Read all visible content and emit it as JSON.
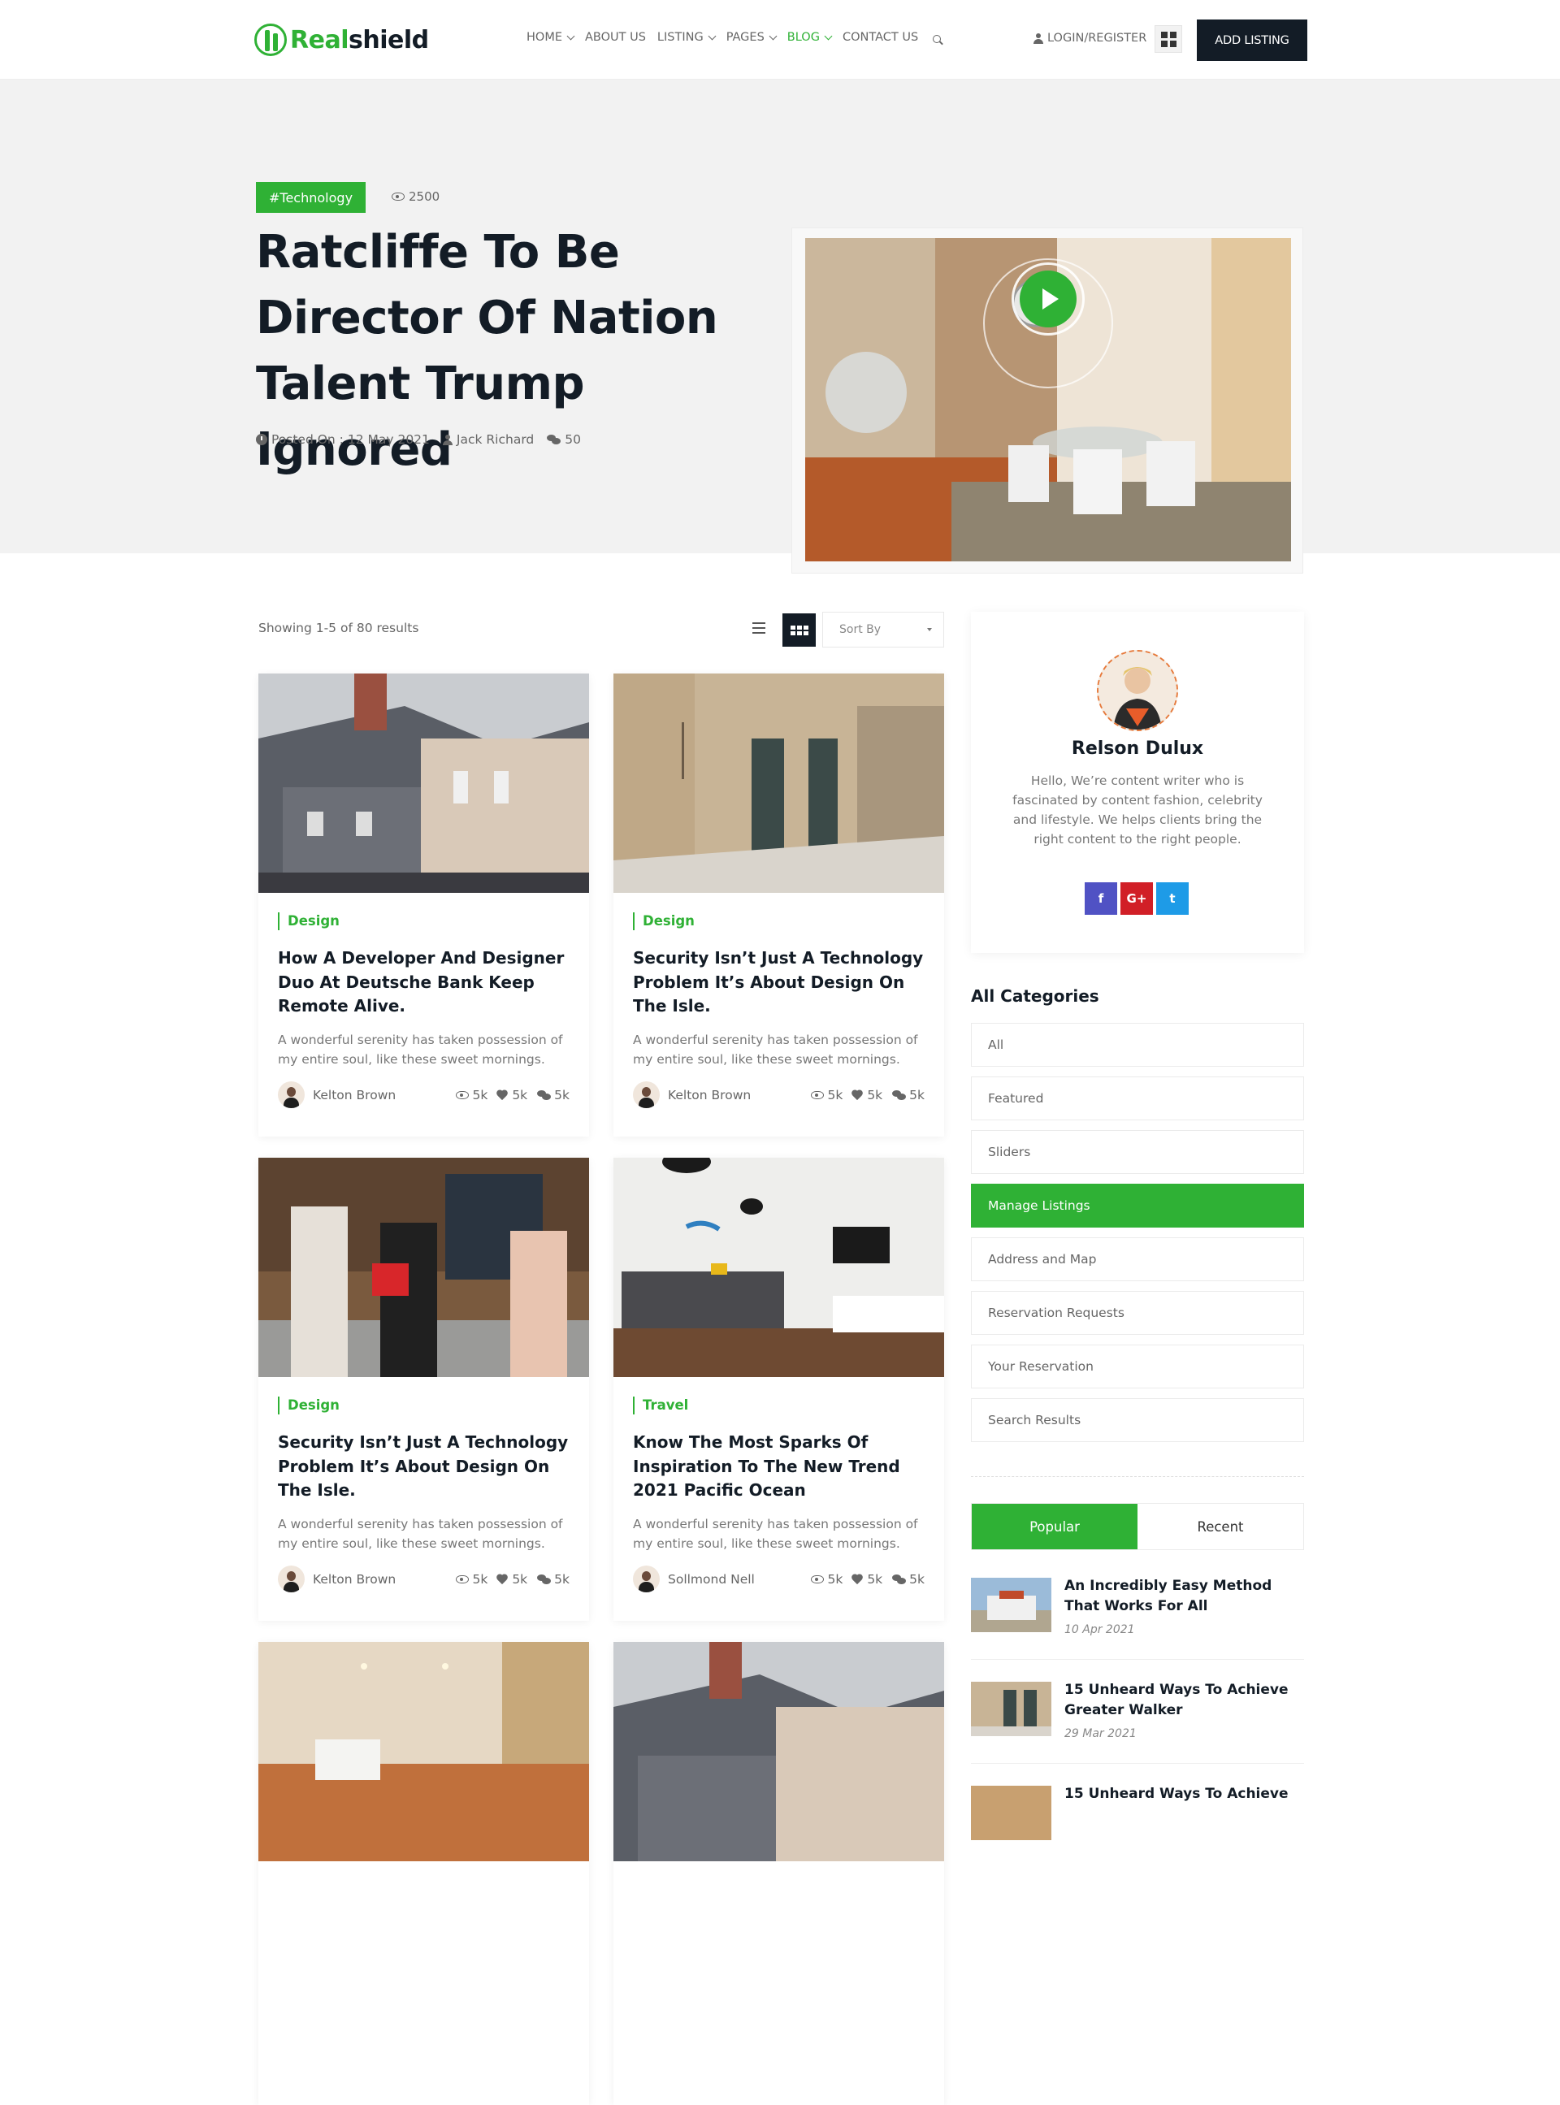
{
  "brand": {
    "logo_part1": "Real",
    "logo_part2": "shield"
  },
  "nav": {
    "items": [
      {
        "label": "HOME",
        "dropdown": true,
        "active": false
      },
      {
        "label": "ABOUT US",
        "dropdown": false,
        "active": false
      },
      {
        "label": "LISTING",
        "dropdown": true,
        "active": false
      },
      {
        "label": "PAGES",
        "dropdown": true,
        "active": false
      },
      {
        "label": "BLOG",
        "dropdown": true,
        "active": true
      },
      {
        "label": "CONTACT US",
        "dropdown": false,
        "active": false
      }
    ],
    "login": "LOGIN/REGISTER",
    "add_listing": "ADD LISTING"
  },
  "hero": {
    "tag": "#Technology",
    "views": "2500",
    "title": "Ratcliffe To Be Director Of Nation Talent Trump Ignored",
    "posted": "Posted On : 12 May 2021",
    "author": "Jack Richard",
    "comments": "50"
  },
  "listing": {
    "showing": "Showing 1-5 of 80 results",
    "sort_placeholder": "Sort By"
  },
  "cards": [
    {
      "category": "Design",
      "title": "How A Developer And Designer Duo At Deutsche Bank Keep Remote Alive.",
      "desc": "A wonderful serenity has taken possession of my entire soul, like these sweet mornings.",
      "author": "Kelton Brown",
      "views": "5k",
      "likes": "5k",
      "comments": "5k"
    },
    {
      "category": "Design",
      "title": "Security Isn’t Just A Technology Problem It’s About Design On The Isle.",
      "desc": "A wonderful serenity has taken possession of my entire soul, like these sweet mornings.",
      "author": "Kelton Brown",
      "views": "5k",
      "likes": "5k",
      "comments": "5k"
    },
    {
      "category": "Design",
      "title": "Security Isn’t Just A Technology Problem It’s About Design On The Isle.",
      "desc": "A wonderful serenity has taken possession of my entire soul, like these sweet mornings.",
      "author": "Kelton Brown",
      "views": "5k",
      "likes": "5k",
      "comments": "5k"
    },
    {
      "category": "Travel",
      "title": "Know The Most Sparks Of Inspiration To The New Trend 2021 Pacific Ocean",
      "desc": "A wonderful serenity has taken possession of my entire soul, like these sweet mornings.",
      "author": "Sollmond Nell",
      "views": "5k",
      "likes": "5k",
      "comments": "5k"
    }
  ],
  "author_box": {
    "name": "Relson Dulux",
    "bio": "Hello, We’re content writer who is fascinated by content fashion, celebrity and lifestyle. We helps clients bring the right content to the right people.",
    "socials": [
      "f",
      "G+",
      "t"
    ]
  },
  "categories": {
    "title": "All Categories",
    "items": [
      "All",
      "Featured",
      "Sliders",
      "Manage Listings",
      "Address and Map",
      "Reservation Requests",
      "Your Reservation",
      "Search Results"
    ],
    "active_index": 3
  },
  "posts_tabs": {
    "popular": "Popular",
    "recent": "Recent"
  },
  "posts": [
    {
      "title": "An Incredibly Easy Method That Works For All",
      "date": "10 Apr 2021"
    },
    {
      "title": "15 Unheard Ways To Achieve Greater Walker",
      "date": "29 Mar 2021"
    },
    {
      "title": "15 Unheard Ways To Achieve",
      "date": ""
    }
  ],
  "colors": {
    "accent": "#2fb135",
    "dark": "#131c26",
    "hero_bg": "#f2f2f2"
  }
}
